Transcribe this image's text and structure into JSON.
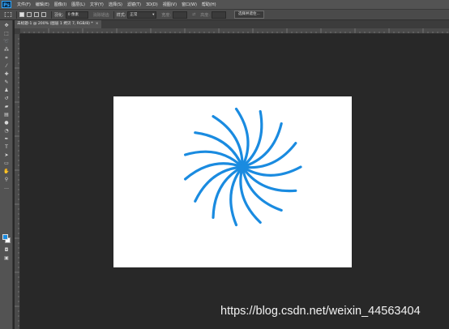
{
  "app": {
    "logo": "Ps"
  },
  "menu": [
    "文件(F)",
    "编辑(E)",
    "图像(I)",
    "图层(L)",
    "文字(Y)",
    "选择(S)",
    "滤镜(T)",
    "3D(D)",
    "视图(V)",
    "窗口(W)",
    "帮助(H)"
  ],
  "options": {
    "feather_label": "羽化:",
    "feather_value": "0 像素",
    "antialias_label": "消除锯齿",
    "style_label": "样式:",
    "style_value": "正常",
    "width_label": "宽度:",
    "height_label": "高度:",
    "select_mask_button": "选择并遮住..."
  },
  "document": {
    "tab_title": "未标题-1 @ 200% (图层 1 拷贝 7, RGB/8) *",
    "tab_close": "×",
    "canvas_background": "#ffffff",
    "shape_color": "#1a8be0",
    "shape": "spiral-sunburst"
  },
  "swatches": {
    "foreground": "#1a8be0",
    "background": "#ffffff"
  },
  "watermark": "https://blog.csdn.net/weixin_44563404"
}
